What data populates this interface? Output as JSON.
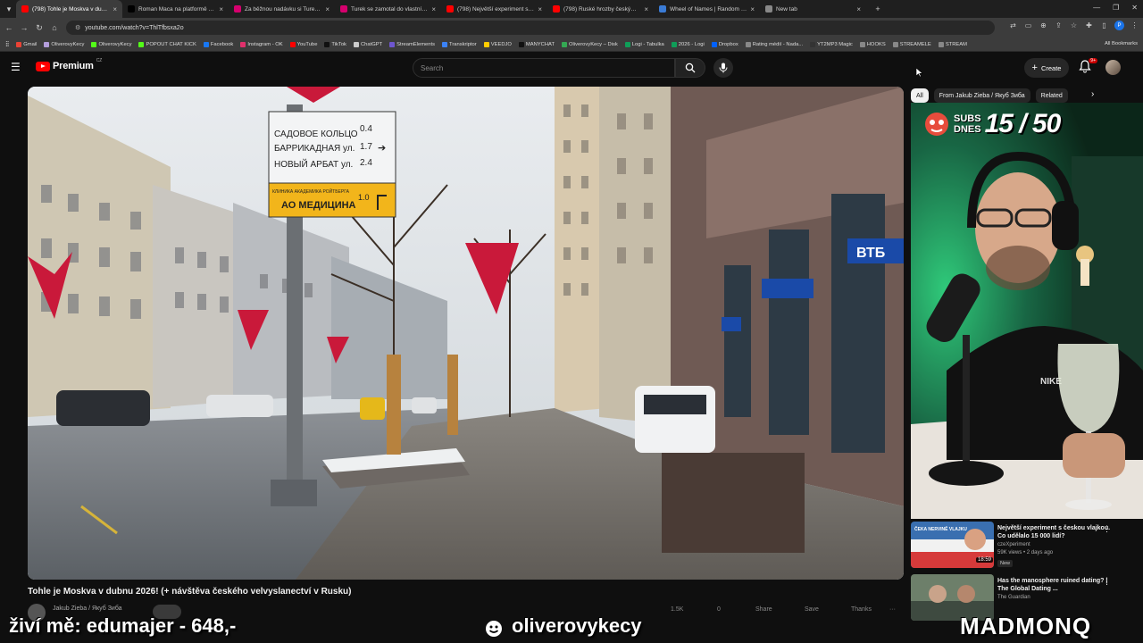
{
  "browser": {
    "tabs": [
      {
        "title": "(798) Tohle je Moskva v dubnu",
        "color": "#ff0000",
        "active": true
      },
      {
        "title": "Roman Maca na platformě X: „...",
        "color": "#000000",
        "active": false
      },
      {
        "title": "Za běžnou nadávku si Turek vy...",
        "color": "#d6006e",
        "active": false
      },
      {
        "title": "Turek se zamotal do vlastních l...",
        "color": "#d6006e",
        "active": false
      },
      {
        "title": "(798) Největší experiment s čes...",
        "color": "#ff0000",
        "active": false
      },
      {
        "title": "(798) Ruské hrozby českým zbr...",
        "color": "#ff0000",
        "active": false
      },
      {
        "title": "Wheel of Names | Random nam...",
        "color": "#3a7bd5",
        "active": false
      },
      {
        "title": "New tab",
        "color": "#888888",
        "active": false
      }
    ],
    "url": "youtube.com/watch?v=ThlTfbsxa2o",
    "profile_letter": "P",
    "bookmarks": [
      {
        "label": "Gmail",
        "color": "#ea4335"
      },
      {
        "label": "OliverovyKecy",
        "color": "#b39ddb"
      },
      {
        "label": "OliverovyKecy",
        "color": "#53fc18"
      },
      {
        "label": "POPOUT CHAT KICK",
        "color": "#53fc18"
      },
      {
        "label": "Facebook",
        "color": "#1877f2"
      },
      {
        "label": "Instagram - OK",
        "color": "#e1306c"
      },
      {
        "label": "YouTube",
        "color": "#ff0000"
      },
      {
        "label": "TikTok",
        "color": "#111111"
      },
      {
        "label": "ChatGPT",
        "color": "#cccccc"
      },
      {
        "label": "StreamElements",
        "color": "#6e56cf"
      },
      {
        "label": "Transkriptor",
        "color": "#3b82f6"
      },
      {
        "label": "VEEDJO",
        "color": "#ffcc00"
      },
      {
        "label": "MANYCHAT",
        "color": "#111111"
      },
      {
        "label": "OliverovyKecy – Disk",
        "color": "#34a853"
      },
      {
        "label": "Logi - Tabulka",
        "color": "#0f9d58"
      },
      {
        "label": "2026 - Logi",
        "color": "#0f9d58"
      },
      {
        "label": "Dropbox",
        "color": "#0061ff"
      },
      {
        "label": "Rating médií - Nada...",
        "color": "#888888"
      },
      {
        "label": "YT2MP3 Magic",
        "color": "#333333"
      },
      {
        "label": "HOOKS",
        "color": "#888888"
      },
      {
        "label": "STREAMELE",
        "color": "#888888"
      },
      {
        "label": "STREAM",
        "color": "#888888"
      }
    ],
    "all_bookmarks": "All Bookmarks"
  },
  "youtube": {
    "logo_text": "Premium",
    "logo_country": "CZ",
    "search_placeholder": "Search",
    "create_label": "Create",
    "notif_count": "9+",
    "video_title": "Tohle je Moskva v dubnu 2026! (+ návštěva českého velvyslanectví v Rusku)",
    "channel_name": "Jakub Zieba / Якуб Зиба",
    "actions": [
      "1.5K",
      "0",
      "Share",
      "Save",
      "Thanks",
      "···"
    ],
    "video_signs": {
      "line1_name": "САДОВОЕ КОЛЬЦО",
      "line1_val": "0.4",
      "line2_name": "БАРРИКАДНАЯ ул.",
      "line2_val": "1.7",
      "line3_name": "НОВЫЙ АРБАТ ул.",
      "line3_val": "2.4",
      "clinic_small": "КЛИНИКА АКАДЕМИКА РОЙТБЕРГА",
      "clinic_name": "АО МЕДИЦИНА",
      "clinic_val": "1.0",
      "bank": "ВТБ"
    },
    "chips": [
      "All",
      "From Jakub Zieba / Якуб Зиба",
      "Related"
    ],
    "subs_label_1": "SUBS",
    "subs_label_2": "DNES",
    "subs_count": "15 / 50",
    "shirt_text": "NIKE",
    "recommendations": [
      {
        "title": "Největší experiment s českou vlajkou. Co udělalo 15 000 lidí?",
        "channel": "czeXperiment",
        "meta": "59K views • 2 days ago",
        "badge": "New",
        "duration": "18:59",
        "thumb_text": "ČEKA NERVINĚ VLAJKU"
      },
      {
        "title": "Has the manosphere ruined dating? | The Global Dating ...",
        "channel": "The Guardian",
        "meta": "",
        "badge": "",
        "duration": "",
        "thumb_text": ""
      }
    ]
  },
  "overlay": {
    "donation": "živí mě: edumajer - 648,-",
    "handle": "oliverovykecy",
    "brand": "MADMONQ"
  }
}
